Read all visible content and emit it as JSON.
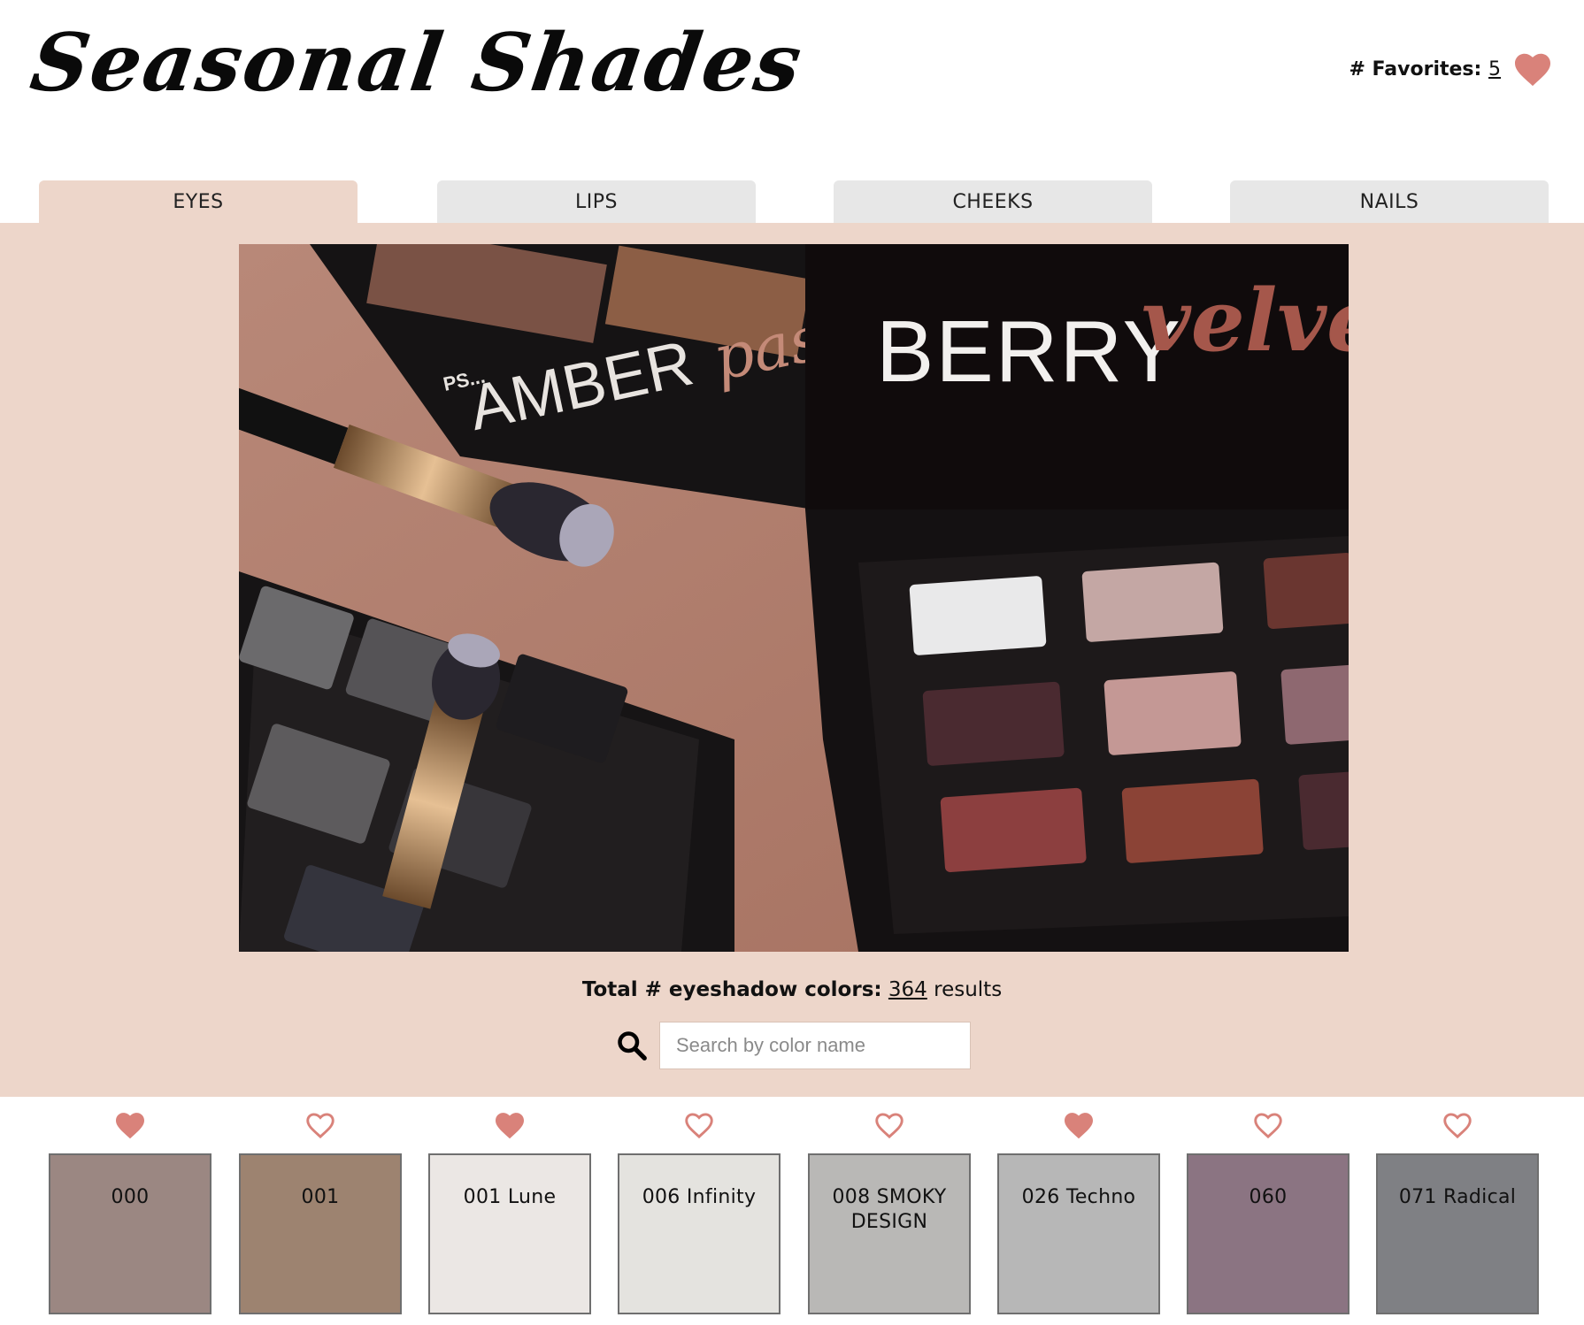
{
  "header": {
    "logo": "Seasonal Shades",
    "favorites_label": "# Favorites:",
    "favorites_count": "5",
    "accent_color": "#d9827a"
  },
  "tabs": [
    {
      "label": "EYES",
      "active": true
    },
    {
      "label": "LIPS",
      "active": false
    },
    {
      "label": "CHEEKS",
      "active": false
    },
    {
      "label": "NAILS",
      "active": false
    }
  ],
  "hero": {
    "background": "#edd6ca",
    "photo_text": {
      "brand_main": "BERRY",
      "brand_script": "velvets",
      "second_brand_prefix": "PS...",
      "second_brand_main": "AMBER",
      "second_brand_script": "pas"
    }
  },
  "results": {
    "label": "Total # eyeshadow colors:",
    "count": "364",
    "suffix": "results"
  },
  "search": {
    "placeholder": "Search by color name",
    "value": ""
  },
  "swatches": [
    {
      "name": "000",
      "color": "#9b8782",
      "favorite": true
    },
    {
      "name": "001",
      "color": "#9d8370",
      "favorite": false
    },
    {
      "name": "001 Lune",
      "color": "#ebe7e4",
      "favorite": true
    },
    {
      "name": "006 Infinity",
      "color": "#e4e3df",
      "favorite": false
    },
    {
      "name": "008 SMOKY DESIGN",
      "color": "#b9b8b6",
      "favorite": false
    },
    {
      "name": "026 Techno",
      "color": "#b7b7b7",
      "favorite": true
    },
    {
      "name": "060",
      "color": "#8b7482",
      "favorite": false
    },
    {
      "name": "071 Radical",
      "color": "#7f8084",
      "favorite": false
    }
  ]
}
